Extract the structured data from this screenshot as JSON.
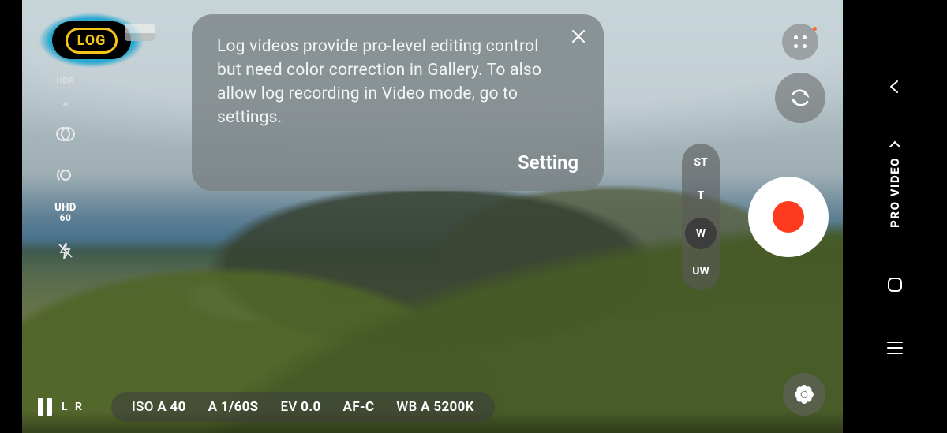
{
  "tooltip": {
    "body": "Log videos provide pro-level editing control but need color correction in Gallery. To also allow log recording in Video mode, go to settings.",
    "action": "Setting"
  },
  "log": {
    "label": "LOG"
  },
  "left_tools": {
    "hdr": "HDR",
    "resolution_line1": "UHD",
    "resolution_line2": "60"
  },
  "zoom": {
    "items": [
      "ST",
      "T",
      "W",
      "UW"
    ],
    "active": "W"
  },
  "bottom": {
    "stereo": "L  R",
    "params": {
      "iso_label": "ISO",
      "iso_value": "A 40",
      "shutter": "A 1/60S",
      "ev_label": "EV",
      "ev_value": "0.0",
      "af": "AF-C",
      "wb_label": "WB",
      "wb_value": "A 5200K"
    }
  },
  "mode": "PRO VIDEO"
}
